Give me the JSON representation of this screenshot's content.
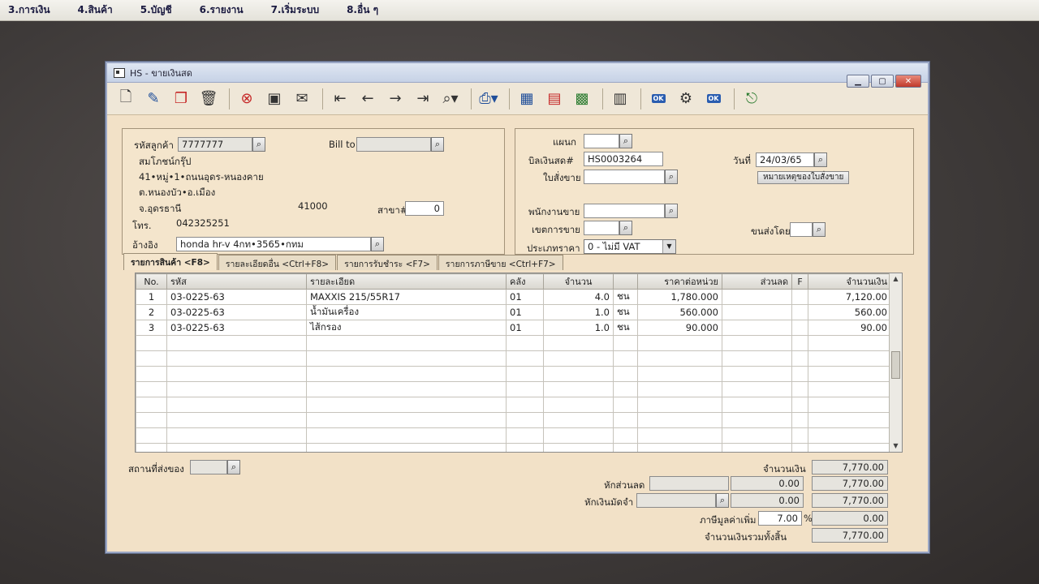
{
  "menu": [
    "3.การเงิน",
    "4.สินค้า",
    "5.บัญชี",
    "6.รายงาน",
    "7.เริ่มระบบ",
    "8.อื่น ๆ"
  ],
  "window": {
    "title": "HS - ขายเงินสด"
  },
  "customer": {
    "code_label": "รหัสลูกค้า",
    "code": "7777777",
    "name": "สมโภชน์กรุ๊ป",
    "address1": "41•หมู่•1•ถนนอุดร-หนองคาย",
    "address2": "ต.หนองบัว•อ.เมือง",
    "province": "จ.อุดรธานี",
    "postcode": "41000",
    "phone_label": "โทร.",
    "phone": "042325251",
    "ref_label": "อ้างอิง",
    "ref": "honda hr-v 4กท•3565•กทม",
    "bill_to_label": "Bill to",
    "bill_to": "",
    "branch_label": "สาขา#",
    "branch": "0"
  },
  "doc": {
    "dept_label": "แผนก",
    "dept": "",
    "bill_label": "บิลเงินสด#",
    "bill_no": "HS0003264",
    "order_label": "ใบสั่งขาย",
    "order": "",
    "date_label": "วันที่",
    "date": "24/03/65",
    "note_button": "หมายเหตุของใบสั่งขาย",
    "salesman_label": "พนักงานขาย",
    "salesman": "",
    "area_label": "เขตการขาย",
    "area": "",
    "price_type_label": "ประเภทราคา",
    "price_type": "0 - ไม่มี VAT",
    "ship_by_label": "ขนส่งโดย",
    "ship_by": ""
  },
  "tabs": [
    "รายการสินค้า <F8>",
    "รายละเอียดอื่น <Ctrl+F8>",
    "รายการรับชำระ <F7>",
    "รายการภาษีขาย <Ctrl+F7>"
  ],
  "grid": {
    "headers": [
      "No.",
      "รหัส",
      "รายละเอียด",
      "คลัง",
      "จำนวน",
      "",
      "ราคาต่อหน่วย",
      "ส่วนลด",
      "F",
      "จำนวนเงิน"
    ],
    "rows": [
      [
        "1",
        "03-0225-63",
        "MAXXIS 215/55R17",
        "01",
        "4.0",
        "ชน",
        "1,780.000",
        "",
        "",
        "7,120.00"
      ],
      [
        "2",
        "03-0225-63",
        "น้ำมันเครื่อง",
        "01",
        "1.0",
        "ชน",
        "560.000",
        "",
        "",
        "560.00"
      ],
      [
        "3",
        "03-0225-63",
        "ไส้กรอง",
        "01",
        "1.0",
        "ชน",
        "90.000",
        "",
        "",
        "90.00"
      ]
    ],
    "empty_rows": 8
  },
  "footer": {
    "ship_place_label": "สถานที่ส่งของ",
    "ship_place": "",
    "amount_label": "จำนวนเงิน",
    "amount": "7,770.00",
    "discount_label": "หักส่วนลด",
    "discount_text": "",
    "discount_value": "0.00",
    "discount_total": "7,770.00",
    "deposit_label": "หักเงินมัดจำ",
    "deposit_text": "",
    "deposit_value": "0.00",
    "deposit_total": "7,770.00",
    "vat_label": "ภาษีมูลค่าเพิ่ม",
    "vat_rate": "7.00",
    "vat_pct": "%",
    "vat_value": "0.00",
    "grand_label": "จำนวนเงินรวมทั้งสิ้น",
    "grand_total": "7,770.00"
  }
}
